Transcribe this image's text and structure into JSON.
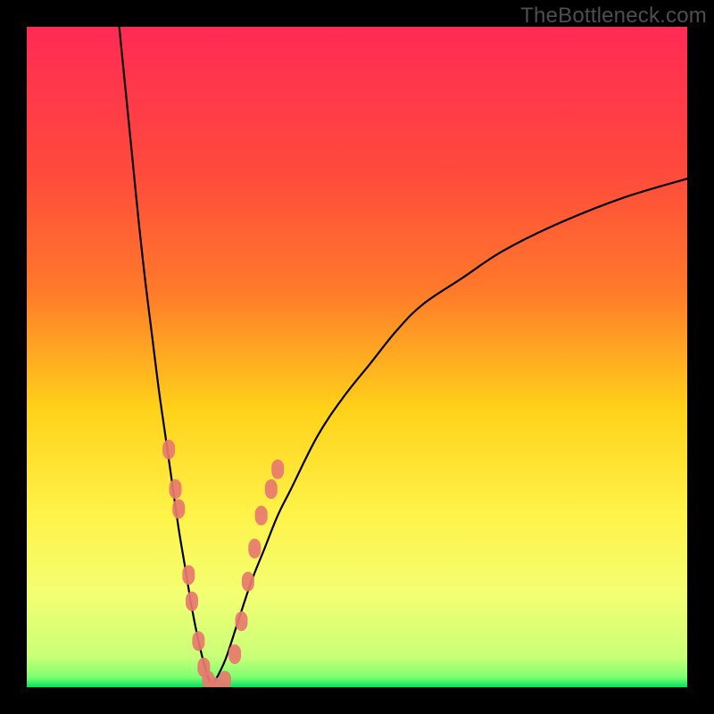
{
  "watermark": "TheBottleneck.com",
  "colors": {
    "gradient_top": "#ff2a55",
    "gradient_mid1": "#ff7a2a",
    "gradient_mid2": "#ffd21a",
    "gradient_mid3": "#fff34a",
    "gradient_mid4": "#f3ff72",
    "gradient_bottom": "#00e060",
    "curve": "#000000",
    "dots": "#e8786f",
    "frame": "#000000"
  },
  "chart_data": {
    "type": "line",
    "title": "",
    "xlabel": "",
    "ylabel": "",
    "xlim": [
      0,
      100
    ],
    "ylim": [
      0,
      100
    ],
    "curve_left": {
      "x": [
        14,
        15,
        16,
        17,
        18,
        19,
        20,
        21,
        22,
        23,
        24,
        25,
        26,
        27,
        28
      ],
      "y": [
        100,
        90,
        80,
        70,
        61,
        53,
        45,
        38,
        31,
        24,
        18,
        12,
        7,
        3,
        0
      ]
    },
    "curve_right": {
      "x": [
        28,
        30,
        32,
        34,
        36,
        38,
        40,
        44,
        48,
        52,
        56,
        60,
        66,
        72,
        80,
        90,
        100
      ],
      "y": [
        0,
        4,
        10,
        16,
        21,
        26,
        30,
        38,
        44,
        49,
        54,
        58,
        62,
        66,
        70,
        74,
        77
      ]
    },
    "dots": [
      {
        "x": 21.5,
        "y": 36
      },
      {
        "x": 22.5,
        "y": 30
      },
      {
        "x": 23.0,
        "y": 27
      },
      {
        "x": 24.5,
        "y": 17
      },
      {
        "x": 25.0,
        "y": 13
      },
      {
        "x": 26.0,
        "y": 7
      },
      {
        "x": 26.8,
        "y": 3
      },
      {
        "x": 27.5,
        "y": 1
      },
      {
        "x": 28.5,
        "y": 0
      },
      {
        "x": 30.0,
        "y": 1
      },
      {
        "x": 31.5,
        "y": 5
      },
      {
        "x": 32.5,
        "y": 10
      },
      {
        "x": 33.5,
        "y": 16
      },
      {
        "x": 34.5,
        "y": 21
      },
      {
        "x": 35.5,
        "y": 26
      },
      {
        "x": 37.0,
        "y": 30
      },
      {
        "x": 38.0,
        "y": 33
      }
    ],
    "green_band": {
      "ymin": 0,
      "ymax": 2
    }
  }
}
